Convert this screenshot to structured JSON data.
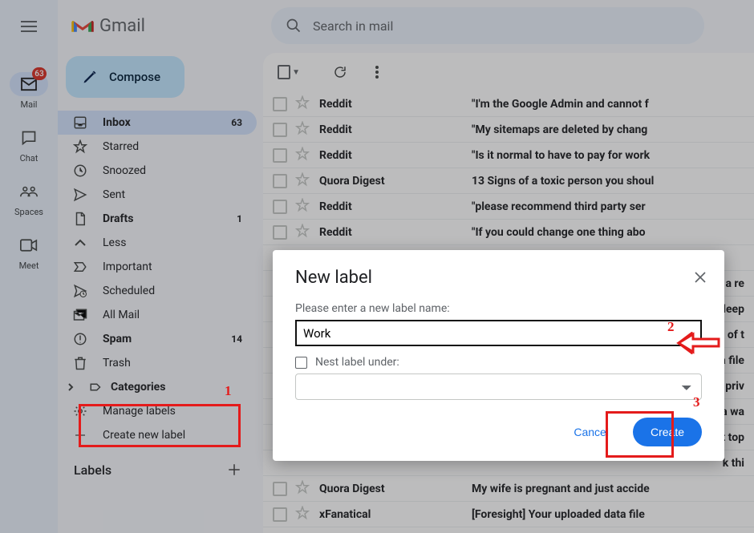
{
  "app_rail": {
    "items": [
      {
        "label": "Mail",
        "badge": "63"
      },
      {
        "label": "Chat"
      },
      {
        "label": "Spaces"
      },
      {
        "label": "Meet"
      }
    ]
  },
  "header": {
    "app_name": "Gmail",
    "search_placeholder": "Search in mail"
  },
  "sidebar": {
    "compose_label": "Compose",
    "items": [
      {
        "label": "Inbox",
        "count": "63",
        "selected": true,
        "bold": true,
        "icon": "inbox"
      },
      {
        "label": "Starred",
        "icon": "star"
      },
      {
        "label": "Snoozed",
        "icon": "clock"
      },
      {
        "label": "Sent",
        "icon": "send"
      },
      {
        "label": "Drafts",
        "count": "1",
        "bold": true,
        "icon": "file"
      },
      {
        "label": "Less",
        "icon": "chevron-up"
      },
      {
        "label": "Important",
        "icon": "important"
      },
      {
        "label": "Scheduled",
        "icon": "scheduled"
      },
      {
        "label": "All Mail",
        "icon": "allmail"
      },
      {
        "label": "Spam",
        "count": "14",
        "bold": true,
        "icon": "spam"
      },
      {
        "label": "Trash",
        "icon": "trash"
      },
      {
        "label": "Categories",
        "bold": true,
        "icon": "categories"
      },
      {
        "label": "Manage labels",
        "icon": "gear"
      },
      {
        "label": "Create new label",
        "icon": "plus"
      }
    ],
    "labels_header": "Labels"
  },
  "emails": [
    {
      "sender": "Reddit",
      "subject": "\"I'm the Google Admin and cannot f"
    },
    {
      "sender": "Reddit",
      "subject": "\"My sitemaps are deleted by chang"
    },
    {
      "sender": "Reddit",
      "subject": "\"Is it normal to have to pay for work"
    },
    {
      "sender": "Quora Digest",
      "subject": "13 Signs of a toxic person you shoul"
    },
    {
      "sender": "Reddit",
      "subject": "\"please recommend third party ser"
    },
    {
      "sender": "Reddit",
      "subject": "\"If you could change one thing abo"
    },
    {
      "sender": "",
      "subject": ""
    },
    {
      "sender": "",
      "subject": "e a re"
    },
    {
      "sender": "",
      "subject": "sleep"
    },
    {
      "sender": "",
      "subject": "s of t"
    },
    {
      "sender": "",
      "subject": " a file"
    },
    {
      "sender": "",
      "subject": "e priv"
    },
    {
      "sender": "",
      "subject": "s a wa"
    },
    {
      "sender": "",
      "subject": "ut top"
    },
    {
      "sender": "",
      "subject": "k thi"
    },
    {
      "sender": "Quora Digest",
      "subject": "My wife is pregnant and just accide"
    },
    {
      "sender": "xFanatical",
      "subject": "[Foresight] Your uploaded data file"
    }
  ],
  "modal": {
    "title": "New label",
    "label_prompt": "Please enter a new label name:",
    "input_value": "Work",
    "nest_label": "Nest label under:",
    "cancel_label": "Cancel",
    "create_label": "Create"
  },
  "annotations": {
    "n1": "1",
    "n2": "2",
    "n3": "3"
  }
}
